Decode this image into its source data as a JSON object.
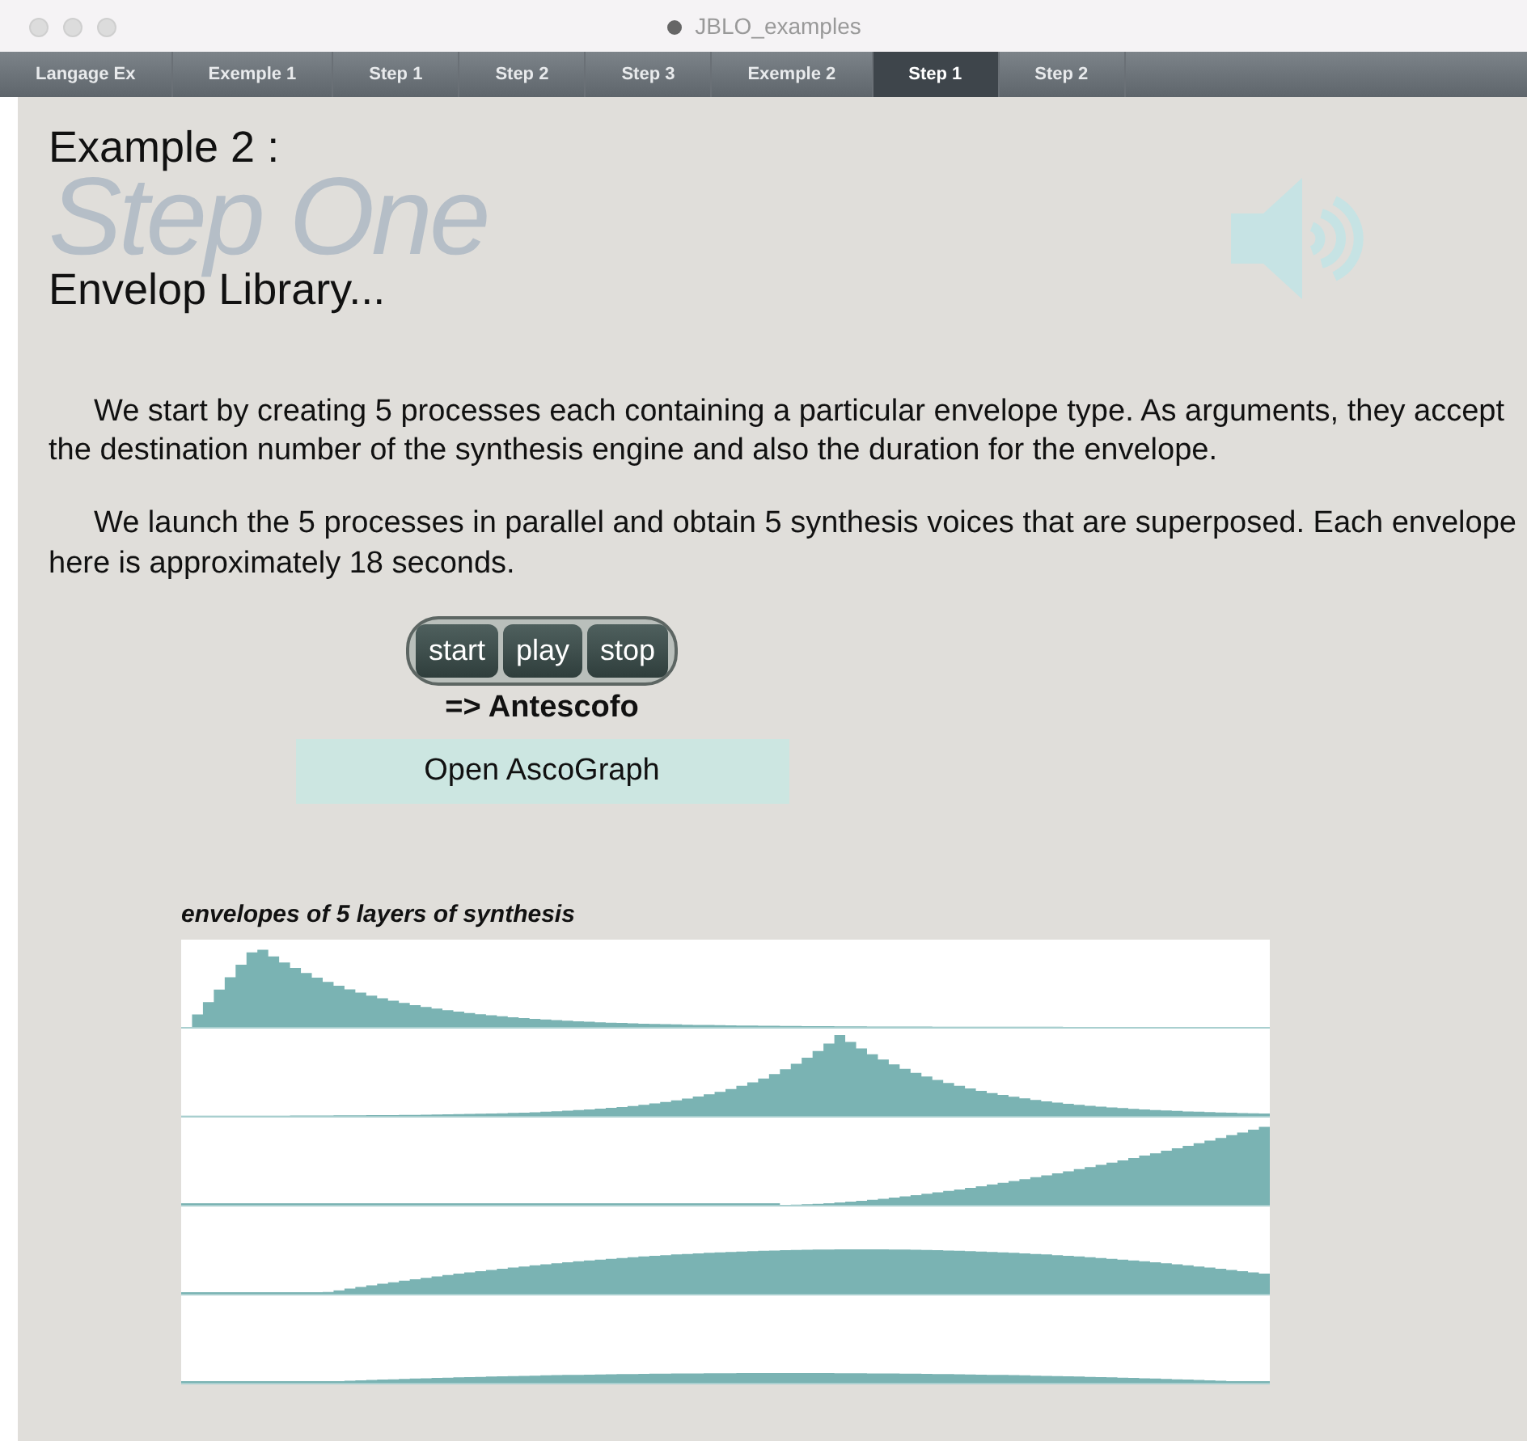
{
  "window": {
    "title": "JBLO_examples"
  },
  "tabs": [
    {
      "label": "Langage Ex",
      "selected": false
    },
    {
      "label": "Exemple 1",
      "selected": false
    },
    {
      "label": "Step 1",
      "selected": false
    },
    {
      "label": "Step 2",
      "selected": false
    },
    {
      "label": "Step 3",
      "selected": false
    },
    {
      "label": "Exemple 2",
      "selected": false
    },
    {
      "label": "Step 1",
      "selected": true
    },
    {
      "label": "Step 2",
      "selected": false
    }
  ],
  "heading": {
    "overline": "Example 2 :",
    "title": "Step One",
    "subtitle": "Envelop Library..."
  },
  "paragraphs": [
    "We start by creating 5 processes each containing a particular envelope type. As arguments, they accept the destination number of the synthesis engine and also the duration for the envelope.",
    "We launch the 5 processes in parallel and obtain 5 synthesis voices that are superposed. Each envelope here is approximately 18 seconds."
  ],
  "transport": {
    "buttons": [
      "start",
      "play",
      "stop"
    ],
    "caption": "=> Antescofo"
  },
  "open_button": "Open AscoGraph",
  "envelopes": {
    "title": "envelopes of 5 layers of synthesis"
  }
}
